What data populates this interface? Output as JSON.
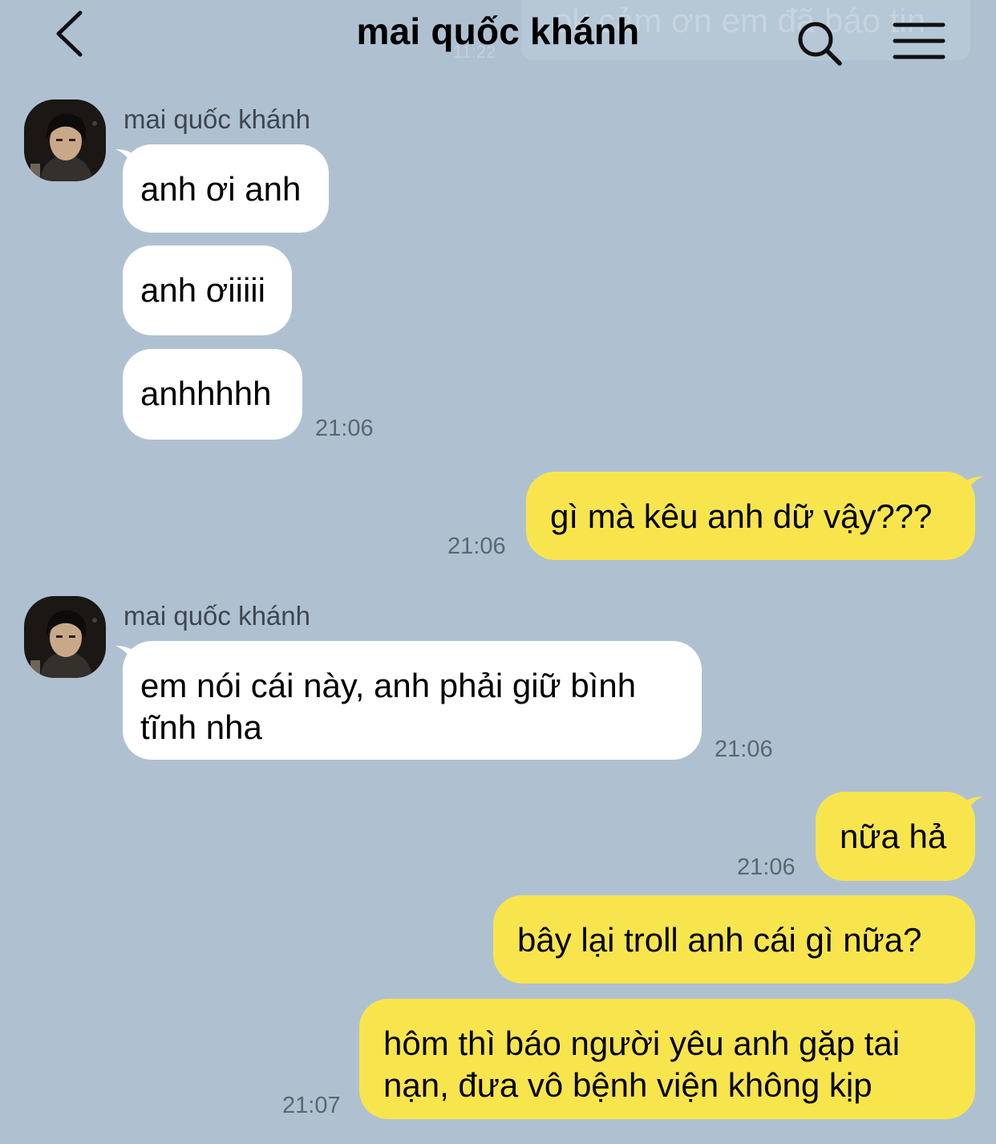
{
  "header": {
    "title": "mai quốc khánh",
    "behind_text": "ok cảm ơn em đã báo tin",
    "behind_time": "11:22"
  },
  "messages": {
    "m1": {
      "sender": "mai quốc khánh",
      "text": "anh ơi anh"
    },
    "m2": {
      "text": "anh ơiiiii"
    },
    "m3": {
      "text": "anhhhhh",
      "time": "21:06"
    },
    "m4": {
      "text": "gì mà kêu anh dữ vậy???",
      "time": "21:06"
    },
    "m5": {
      "sender": "mai quốc khánh",
      "line1": "em nói cái này, anh phải giữ bình",
      "line2": "tĩnh nha",
      "time": "21:06"
    },
    "m6": {
      "text": "nữa hả",
      "time": "21:06"
    },
    "m7": {
      "text": "bây lại troll anh cái gì nữa?"
    },
    "m8": {
      "line1": "hôm thì báo người yêu anh gặp tai",
      "line2": "nạn, đưa vô bệnh viện không kịp",
      "time": "21:07"
    }
  },
  "colors": {
    "background": "#afc1d1",
    "incoming_bubble": "#ffffff",
    "outgoing_bubble": "#f8e54d",
    "timestamp": "#5b6672"
  },
  "icons": {
    "back": "chevron-left-icon",
    "search": "search-icon",
    "menu": "hamburger-menu-icon"
  }
}
